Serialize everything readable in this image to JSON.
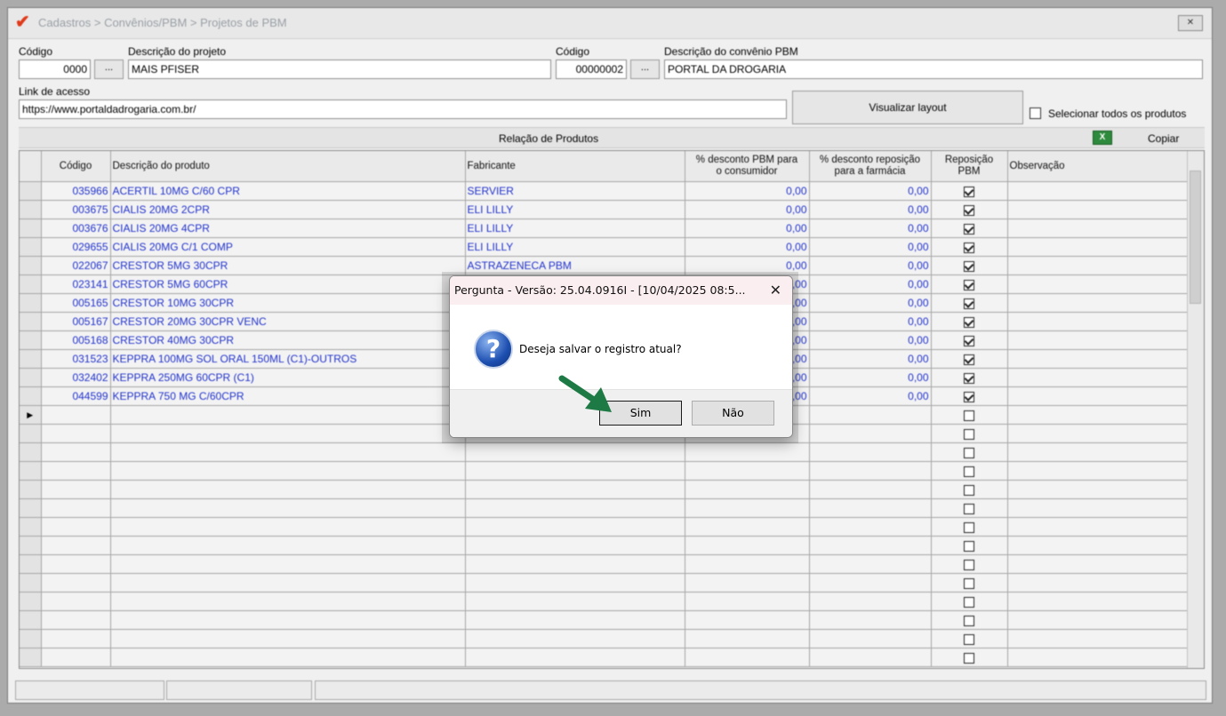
{
  "window": {
    "title": "Cadastros > Convênios/PBM > Projetos de PBM",
    "close_label": "✕"
  },
  "form": {
    "codigo_label": "Código",
    "codigo_value": "0000",
    "lookup_label": "...",
    "descricao_label": "Descrição do projeto",
    "descricao_value": "MAIS PFISER",
    "codigo2_label": "Código",
    "codigo2_value": "00000002",
    "convenio_label": "Descrição do convênio PBM",
    "convenio_value": "PORTAL DA DROGARIA",
    "link_label": "Link de acesso",
    "link_value": "https://www.portaldadrogaria.com.br/",
    "view_layout_button": "Visualizar layout",
    "select_all_label": "Selecionar todos os produtos"
  },
  "relacao": {
    "title": "Relação de Produtos",
    "copy_label": "Copiar"
  },
  "grid": {
    "headers": {
      "codigo": "Código",
      "descricao": "Descrição do produto",
      "fabricante": "Fabricante",
      "desc_pbm_1": "% desconto PBM para",
      "desc_pbm_2": "o consumidor",
      "desc_rep_1": "% desconto reposição",
      "desc_rep_2": "para a farmácia",
      "reposicao_1": "Reposição",
      "reposicao_2": "PBM",
      "observacao": "Observação"
    },
    "rows": [
      {
        "codigo": "035966",
        "descricao": "ACERTIL 10MG C/60 CPR",
        "fabricante": "SERVIER",
        "desc_pbm": "0,00",
        "desc_rep": "0,00",
        "reposicao": true
      },
      {
        "codigo": "003675",
        "descricao": "CIALIS 20MG 2CPR",
        "fabricante": "ELI LILLY",
        "desc_pbm": "0,00",
        "desc_rep": "0,00",
        "reposicao": true
      },
      {
        "codigo": "003676",
        "descricao": "CIALIS 20MG 4CPR",
        "fabricante": "ELI LILLY",
        "desc_pbm": "0,00",
        "desc_rep": "0,00",
        "reposicao": true
      },
      {
        "codigo": "029655",
        "descricao": "CIALIS 20MG C/1 COMP",
        "fabricante": "ELI LILLY",
        "desc_pbm": "0,00",
        "desc_rep": "0,00",
        "reposicao": true
      },
      {
        "codigo": "022067",
        "descricao": "CRESTOR  5MG 30CPR",
        "fabricante": "ASTRAZENECA PBM",
        "desc_pbm": "0,00",
        "desc_rep": "0,00",
        "reposicao": true
      },
      {
        "codigo": "023141",
        "descricao": "CRESTOR  5MG 60CPR",
        "fabricante": "",
        "desc_pbm": "0,00",
        "desc_rep": "0,00",
        "reposicao": true
      },
      {
        "codigo": "005165",
        "descricao": "CRESTOR 10MG 30CPR",
        "fabricante": "",
        "desc_pbm": "0,00",
        "desc_rep": "0,00",
        "reposicao": true
      },
      {
        "codigo": "005167",
        "descricao": "CRESTOR 20MG 30CPR VENC",
        "fabricante": "",
        "desc_pbm": "0,00",
        "desc_rep": "0,00",
        "reposicao": true
      },
      {
        "codigo": "005168",
        "descricao": "CRESTOR 40MG 30CPR",
        "fabricante": "",
        "desc_pbm": "0,00",
        "desc_rep": "0,00",
        "reposicao": true
      },
      {
        "codigo": "031523",
        "descricao": "KEPPRA 100MG SOL ORAL 150ML (C1)-OUTROS",
        "fabricante": "",
        "desc_pbm": "0,00",
        "desc_rep": "0,00",
        "reposicao": true
      },
      {
        "codigo": "032402",
        "descricao": "KEPPRA 250MG 60CPR (C1)",
        "fabricante": "",
        "desc_pbm": "0,00",
        "desc_rep": "0,00",
        "reposicao": true
      },
      {
        "codigo": "044599",
        "descricao": "KEPPRA 750 MG C/60CPR",
        "fabricante": "",
        "desc_pbm": "0,00",
        "desc_rep": "0,00",
        "reposicao": true
      }
    ],
    "empty_row_count": 14
  },
  "dialog": {
    "title": "Pergunta - Versão: 25.04.0916I - [10/04/2025 08:5...",
    "close_label": "✕",
    "message": "Deseja salvar o registro atual?",
    "yes_label": "Sim",
    "no_label": "Não",
    "icon": "question-icon"
  },
  "colors": {
    "link_blue": "#2233cc",
    "arrow_green": "#1e7a45",
    "dialog_title_bg": "#fbeef1"
  }
}
